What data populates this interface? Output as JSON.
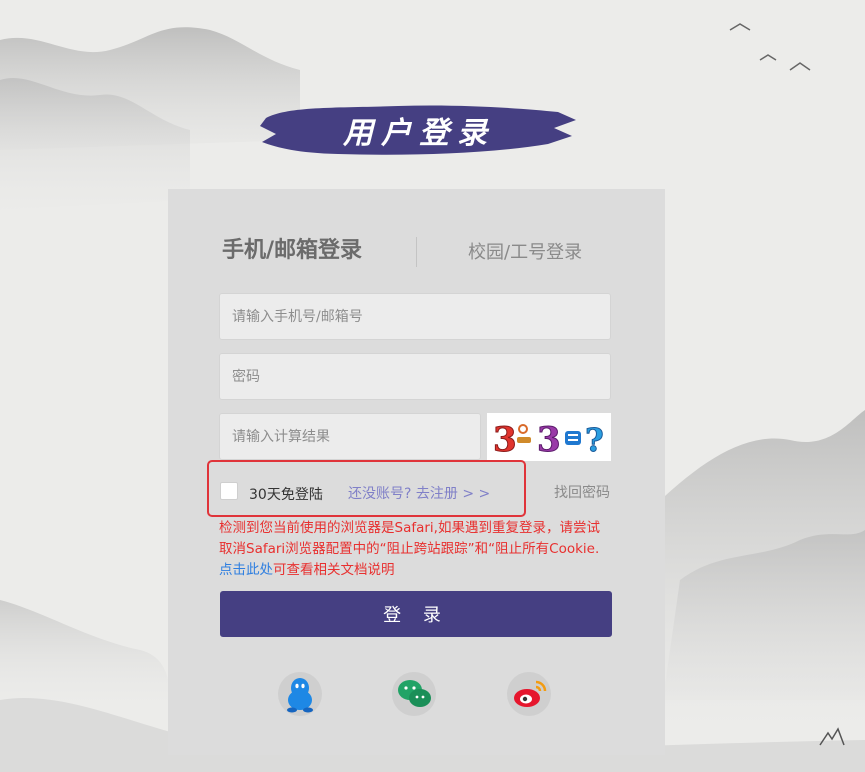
{
  "page_title": "用户登录",
  "tabs": [
    {
      "label": "手机/邮箱登录",
      "active": true
    },
    {
      "label": "校园/工号登录",
      "active": false
    }
  ],
  "form": {
    "account_placeholder": "请输入手机号/邮箱号",
    "password_placeholder": "密码",
    "captcha_placeholder": "请输入计算结果",
    "captcha_expression": "3 - 3 = ?",
    "remember_label": "30天免登陆",
    "register_link": "还没账号? 去注册 > >",
    "forgot_link": "找回密码"
  },
  "warning": {
    "text_before_link": "检测到您当前使用的浏览器是Safari,如果遇到重复登录，请尝试取消Safari浏览器配置中的“阻止跨站跟踪”和“阻止所有Cookie. ",
    "link_text": "点击此处",
    "text_after_link": "可查看相关文档说明"
  },
  "login_button": "登 录",
  "social_logins": [
    {
      "name": "qq",
      "icon": "qq-penguin-icon",
      "color": "#1e88e5"
    },
    {
      "name": "wechat",
      "icon": "wechat-bubbles-icon",
      "color": "#21a366"
    },
    {
      "name": "weibo",
      "icon": "weibo-icon",
      "color": "#e6162d"
    }
  ],
  "colors": {
    "brand": "#453f82",
    "warning": "#e8302f",
    "highlight": "#e0343a",
    "link": "#8080c8"
  }
}
